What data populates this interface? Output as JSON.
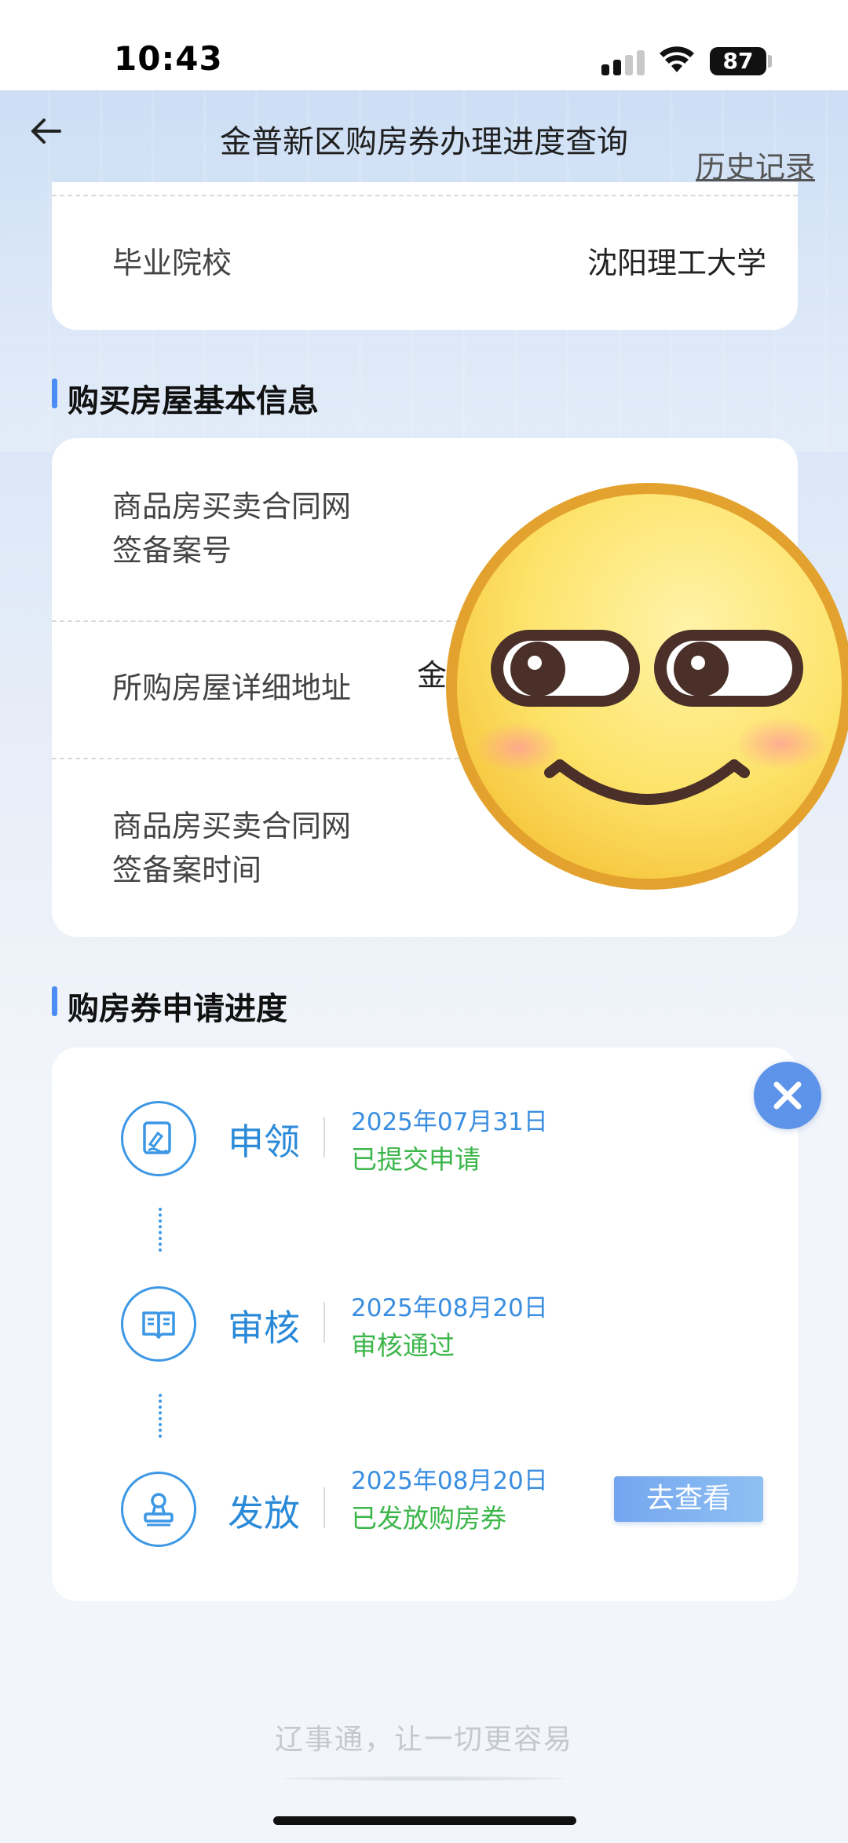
{
  "status_bar": {
    "time": "10:43",
    "battery": "87"
  },
  "header": {
    "title": "金普新区购房券办理进度查询",
    "history_link": "历史记录"
  },
  "education": {
    "school_label": "毕业院校",
    "school_value": "沈阳理工大学"
  },
  "house_info": {
    "section_title": "购买房屋基本信息",
    "contract_no_label": "商品房买卖合同网签备案号",
    "address_label": "所购房屋详细地址",
    "address_value_partial": "金",
    "contract_time_label": "商品房买卖合同网签备案时间"
  },
  "progress": {
    "section_title": "购房券申请进度",
    "steps": [
      {
        "name": "申领",
        "date": "2025年07月31日",
        "status": "已提交申请",
        "icon": "form-icon"
      },
      {
        "name": "审核",
        "date": "2025年08月20日",
        "status": "审核通过",
        "icon": "book-icon"
      },
      {
        "name": "发放",
        "date": "2025年08月20日",
        "status": "已发放购房券",
        "icon": "stamp-icon"
      }
    ],
    "view_button": "去查看"
  },
  "footer": {
    "slogan": "辽事通，让一切更容易"
  },
  "colors": {
    "accent": "#3c97e5",
    "success": "#3cb64a",
    "button": "#74a6f0",
    "close": "#5e93ea"
  },
  "overlay": {
    "emoji": "smirk-emoji-sticker"
  }
}
